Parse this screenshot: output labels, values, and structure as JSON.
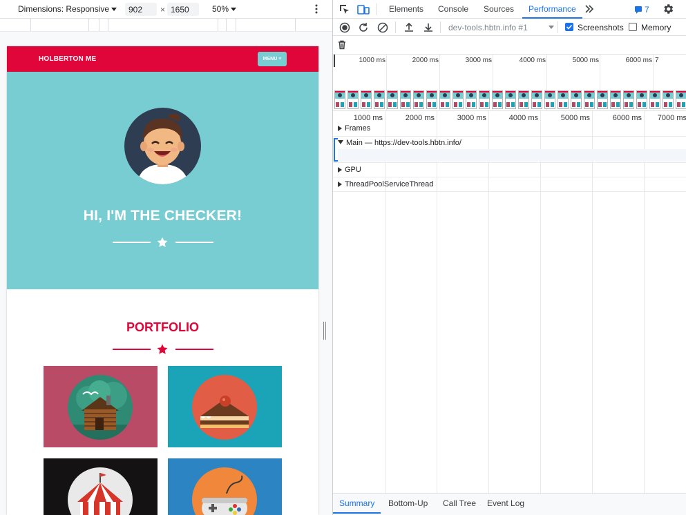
{
  "device_toolbar": {
    "dimensions_label": "Dimensions: Responsive",
    "width": "902",
    "times": "×",
    "height": "1650",
    "zoom": "50%"
  },
  "site": {
    "brand": "HOLBERTON ME",
    "menu_label": "MENU ≡",
    "hero_title": "HI, I'M THE CHECKER!",
    "portfolio_title": "PORTFOLIO",
    "colors": {
      "nav": "#e0063a",
      "hero": "#78cdd2",
      "accent": "#e0063a"
    },
    "tiles": [
      {
        "name": "cabin",
        "bg": "#b94b66",
        "circle": "#2f8a74"
      },
      {
        "name": "cake",
        "bg": "#1ba3b8",
        "circle": "#e25d45"
      },
      {
        "name": "circus-tent",
        "bg": "#141212",
        "circle": "#e9e9e9"
      },
      {
        "name": "game-controller",
        "bg": "#2d84c2",
        "circle": "#f0873a"
      }
    ]
  },
  "devtools": {
    "tabs": [
      "Elements",
      "Console",
      "Sources",
      "Performance"
    ],
    "active_tab": "Performance",
    "issues_count": "7",
    "url_select": "dev-tools.hbtn.info #1",
    "screenshots_label": "Screenshots",
    "memory_label": "Memory",
    "screenshots_checked": true,
    "memory_checked": false,
    "overview_ticks": [
      "1000 ms",
      "2000 ms",
      "3000 ms",
      "4000 ms",
      "5000 ms",
      "6000 ms",
      "7"
    ],
    "timeline_ticks": [
      "1000 ms",
      "2000 ms",
      "3000 ms",
      "4000 ms",
      "5000 ms",
      "6000 ms",
      "7000 ms"
    ],
    "tracks": {
      "frames": "Frames",
      "main": "Main — https://dev-tools.hbtn.info/",
      "gpu": "GPU",
      "threadpool": "ThreadPoolServiceThread"
    },
    "bottom_tabs": [
      "Summary",
      "Bottom-Up",
      "Call Tree",
      "Event Log"
    ],
    "accent": "#1a73e8"
  }
}
